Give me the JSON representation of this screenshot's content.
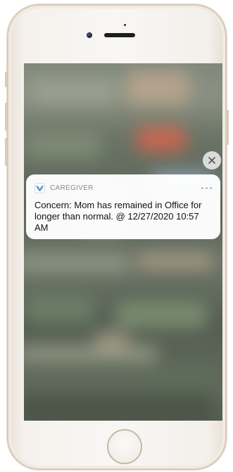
{
  "notification": {
    "app_name": "CAREGIVER",
    "message": "Concern: Mom has remained in Office for longer than normal. @ 12/27/2020 10:57 AM",
    "app_icon": "caregiver-logo-icon",
    "more_icon": "more-dots-icon",
    "close_icon": "close-icon"
  },
  "device": {
    "frame": "iphone-gold",
    "home_button_icon": "home-button-icon"
  },
  "colors": {
    "notification_bg": "#ffffff",
    "app_name_text": "#8a8a8e",
    "message_text": "#111111",
    "logo_accent": "#2f6fb8"
  }
}
